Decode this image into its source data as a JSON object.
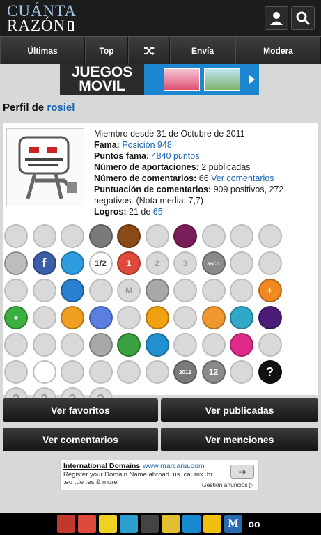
{
  "header": {
    "logo_line1": "CUÁNTA",
    "logo_line2": "RAZÓN"
  },
  "nav": [
    "Últimas",
    "Top",
    "",
    "Envía",
    "Modera"
  ],
  "banner": {
    "text_line1": "JUEGOS",
    "text_line2": "MOVIL"
  },
  "profile": {
    "title_prefix": "Perfil de",
    "username": "rosiel",
    "member_since": "Miembro desde 31 de Octubre de 2011",
    "fame_label": "Fama:",
    "fame_value": "Posición 948",
    "fame_points_label": "Puntos fama:",
    "fame_points_value": "4840 puntos",
    "contributions_label": "Número de aportaciones:",
    "contributions_value": "2 publicadas",
    "comments_label": "Número de comentarios:",
    "comments_value": "66",
    "comments_link": "Ver comentarios",
    "comment_score_label": "Puntuación de comentarios:",
    "comment_score_value": "909 positivos, 272 negativos. (Nota media: 7,7)",
    "achievements_label": "Logros:",
    "achievements_value": "21 de",
    "achievements_total": "65"
  },
  "badges": [
    {
      "name": "badge-pin",
      "color": "#d9d9d9",
      "text": ""
    },
    {
      "name": "badge-frame",
      "color": "#d9d9d9",
      "text": ""
    },
    {
      "name": "badge-screen",
      "color": "#d9d9d9",
      "text": ""
    },
    {
      "name": "badge-tv",
      "color": "#7a7a7a",
      "text": ""
    },
    {
      "name": "badge-tv-retro",
      "color": "#8a4a18",
      "text": ""
    },
    {
      "name": "badge-crown-grey",
      "color": "#d9d9d9",
      "text": ""
    },
    {
      "name": "badge-crown",
      "color": "#7a1e5a",
      "text": ""
    },
    {
      "name": "badge-cup-1",
      "color": "#d9d9d9",
      "text": ""
    },
    {
      "name": "badge-cup-2",
      "color": "#d9d9d9",
      "text": ""
    },
    {
      "name": "badge-cup-3",
      "color": "#d9d9d9",
      "text": ""
    },
    {
      "name": "badge-ring",
      "color": "#bdbdbd",
      "text": ""
    },
    {
      "name": "badge-facebook",
      "color": "#3b5ea8",
      "text": "f"
    },
    {
      "name": "badge-twitter",
      "color": "#2e9de0",
      "text": ""
    },
    {
      "name": "badge-half",
      "color": "#ffffff",
      "text": "1/2"
    },
    {
      "name": "badge-number-1",
      "color": "#e04a3a",
      "text": "1"
    },
    {
      "name": "badge-number-2",
      "color": "#d9d9d9",
      "text": "2"
    },
    {
      "name": "badge-number-3",
      "color": "#d9d9d9",
      "text": "3"
    },
    {
      "name": "badge-asco-grey",
      "color": "#8a8a8a",
      "text": "asco"
    },
    {
      "name": "badge-calendar-grey",
      "color": "#d9d9d9",
      "text": ""
    },
    {
      "name": "badge-search",
      "color": "#d9d9d9",
      "text": ""
    },
    {
      "name": "badge-character",
      "color": "#d9d9d9",
      "text": ""
    },
    {
      "name": "badge-troll",
      "color": "#d9d9d9",
      "text": ""
    },
    {
      "name": "badge-square",
      "color": "#2a7fd0",
      "text": ""
    },
    {
      "name": "badge-chess",
      "color": "#d9d9d9",
      "text": ""
    },
    {
      "name": "badge-letter-m",
      "color": "#d9d9d9",
      "text": "M"
    },
    {
      "name": "badge-cat",
      "color": "#a8a8a8",
      "text": ""
    },
    {
      "name": "badge-thumb",
      "color": "#d9d9d9",
      "text": ""
    },
    {
      "name": "badge-thumb-up",
      "color": "#d9d9d9",
      "text": ""
    },
    {
      "name": "badge-like",
      "color": "#d9d9d9",
      "text": ""
    },
    {
      "name": "badge-plus-orange",
      "color": "#f08a20",
      "text": "+"
    },
    {
      "name": "badge-plus-green",
      "color": "#3ab040",
      "text": "+"
    },
    {
      "name": "badge-horse",
      "color": "#d9d9d9",
      "text": ""
    },
    {
      "name": "badge-glasses",
      "color": "#f0a020",
      "text": ""
    },
    {
      "name": "badge-calendar",
      "color": "#5a7fe0",
      "text": ""
    },
    {
      "name": "badge-grid",
      "color": "#d9d9d9",
      "text": ""
    },
    {
      "name": "badge-pacifier",
      "color": "#f0a010",
      "text": ""
    },
    {
      "name": "badge-pencil",
      "color": "#d9d9d9",
      "text": ""
    },
    {
      "name": "badge-camera",
      "color": "#f09830",
      "text": ""
    },
    {
      "name": "badge-alarm",
      "color": "#30a8c8",
      "text": ""
    },
    {
      "name": "badge-moon",
      "color": "#4a1e78",
      "text": ""
    },
    {
      "name": "badge-chat",
      "color": "#d9d9d9",
      "text": ""
    },
    {
      "name": "badge-globe",
      "color": "#d9d9d9",
      "text": ""
    },
    {
      "name": "badge-star",
      "color": "#d9d9d9",
      "text": ""
    },
    {
      "name": "badge-star-2",
      "color": "#a8a8a8",
      "text": ""
    },
    {
      "name": "badge-frogs",
      "color": "#3aa040",
      "text": ""
    },
    {
      "name": "badge-wave",
      "color": "#2090d0",
      "text": ""
    },
    {
      "name": "badge-blank-1",
      "color": "#d9d9d9",
      "text": ""
    },
    {
      "name": "badge-blank-2",
      "color": "#d9d9d9",
      "text": ""
    },
    {
      "name": "badge-heart",
      "color": "#e02a8a",
      "text": ""
    },
    {
      "name": "badge-leaf",
      "color": "#d9d9d9",
      "text": ""
    },
    {
      "name": "badge-skull",
      "color": "#d9d9d9",
      "text": ""
    },
    {
      "name": "badge-olympics",
      "color": "#ffffff",
      "text": ""
    },
    {
      "name": "badge-blank-3",
      "color": "#d9d9d9",
      "text": ""
    },
    {
      "name": "badge-dove",
      "color": "#d9d9d9",
      "text": ""
    },
    {
      "name": "badge-pumpkin",
      "color": "#d9d9d9",
      "text": ""
    },
    {
      "name": "badge-face",
      "color": "#d9d9d9",
      "text": ""
    },
    {
      "name": "badge-2012",
      "color": "#7a7a7a",
      "text": "2012"
    },
    {
      "name": "badge-number-12",
      "color": "#8a8a8a",
      "text": "12"
    },
    {
      "name": "badge-lines",
      "color": "#d9d9d9",
      "text": ""
    },
    {
      "name": "badge-question-black",
      "color": "#111111",
      "text": "?"
    },
    {
      "name": "badge-question-1",
      "color": "#d9d9d9",
      "text": "?"
    },
    {
      "name": "badge-question-2",
      "color": "#d9d9d9",
      "text": "?"
    },
    {
      "name": "badge-question-3",
      "color": "#d9d9d9",
      "text": "?"
    },
    {
      "name": "badge-question-4",
      "color": "#d9d9d9",
      "text": "?"
    }
  ],
  "buttons": {
    "favorites": "Ver favoritos",
    "published": "Ver publicadas",
    "comments": "Ver comentarios",
    "mentions": "Ver menciones"
  },
  "ad": {
    "title": "International Domains",
    "url": "www.marcaria.com",
    "description": "Register your Domain Name abroad .us .ca .mx .br .eu .de .es & more",
    "note": "Gestión anuncios ▷"
  },
  "footer_icons": [
    "asco de vida",
    "calendar",
    "banana",
    "cuanto fb",
    "film",
    "paint",
    "dog",
    "mouse",
    "M",
    "eyes"
  ]
}
